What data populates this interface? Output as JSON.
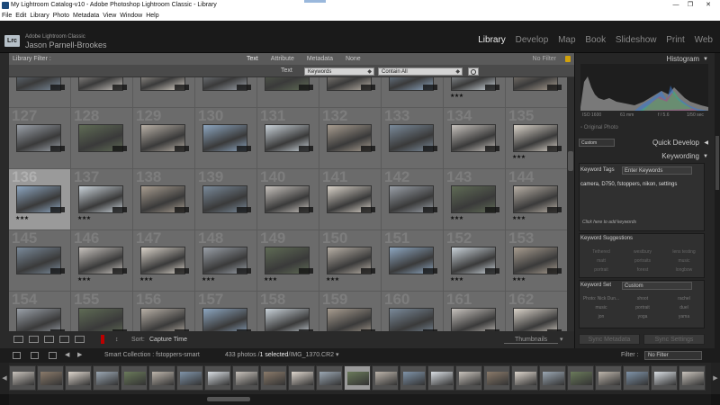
{
  "window": {
    "title": "My Lightroom Catalog-v10 - Adobe Photoshop Lightroom Classic - Library"
  },
  "menu": [
    "File",
    "Edit",
    "Library",
    "Photo",
    "Metadata",
    "View",
    "Window",
    "Help"
  ],
  "identity": {
    "logo": "Lrc",
    "app": "Adobe Lightroom Classic",
    "user": "Jason Parnell-Brookes"
  },
  "modules": [
    "Library",
    "Develop",
    "Map",
    "Book",
    "Slideshow",
    "Print",
    "Web"
  ],
  "active_module": "Library",
  "filter_bar": {
    "label": "Library Filter :",
    "tabs": [
      "Text",
      "Attribute",
      "Metadata",
      "None"
    ],
    "active_tab": "Text",
    "preset": "No Filter",
    "text_label": "Text",
    "field": "Keywords",
    "rule": "Contain All"
  },
  "grid_rows": [
    {
      "nums": [
        "",
        "",
        "",
        "",
        "",
        "",
        "",
        "",
        ""
      ],
      "stars": [
        "",
        "",
        "",
        "",
        "",
        "",
        "",
        "★★★",
        ""
      ]
    },
    {
      "nums": [
        "127",
        "128",
        "129",
        "130",
        "131",
        "132",
        "133",
        "134",
        "135"
      ],
      "stars": [
        "",
        "",
        "",
        "",
        "",
        "",
        "",
        "",
        "★★★"
      ]
    },
    {
      "nums": [
        "136",
        "137",
        "138",
        "139",
        "140",
        "141",
        "142",
        "143",
        "144"
      ],
      "stars": [
        "★★★",
        "★★★",
        "",
        "",
        "",
        "",
        "",
        "★★★",
        "★★★"
      ]
    },
    {
      "nums": [
        "145",
        "146",
        "147",
        "148",
        "149",
        "150",
        "151",
        "152",
        "153"
      ],
      "stars": [
        "",
        "★★★",
        "★★★",
        "★★★",
        "★★★",
        "★★★",
        "",
        "★★★",
        "★★★"
      ]
    },
    {
      "nums": [
        "154",
        "155",
        "156",
        "157",
        "158",
        "159",
        "160",
        "161",
        "162"
      ],
      "stars": [
        "",
        "",
        "",
        "",
        "",
        "",
        "",
        "",
        ""
      ]
    }
  ],
  "selected_photo": "136",
  "toolbar": {
    "sort_label": "Sort:",
    "sort_value": "Capture Time",
    "thumbnails_label": "Thumbnails"
  },
  "right_panel": {
    "histogram_title": "Histogram",
    "exif": {
      "iso": "ISO 1600",
      "focal": "61 mm",
      "aperture": "f / 5.6",
      "shutter": "1/50 sec"
    },
    "original_photo": "Original Photo",
    "quick_develop": {
      "title": "Quick Develop",
      "preset": "Custom"
    },
    "keywording": {
      "title": "Keywording",
      "tags_label": "Keyword Tags",
      "tags_mode": "Enter Keywords",
      "keywords": "camera, D750, fstoppers, nikon, settings",
      "click_hint": "Click here to add keywords",
      "suggestions_title": "Keyword Suggestions",
      "suggestions": [
        "Tethered",
        "westbury",
        "lens testing",
        "matt",
        "portraits",
        "music",
        "portrait",
        "forest",
        "longbow"
      ],
      "set_label": "Keyword Set",
      "set_value": "Custom",
      "set_items": [
        "Photo: Nick Dun...",
        "shoot",
        "rachel",
        "music",
        "portrait",
        "duel",
        "jon",
        "yoga",
        "yama"
      ]
    },
    "buttons": {
      "sync_metadata": "Sync Metadata",
      "sync_settings": "Sync Settings"
    }
  },
  "filmstrip_bar": {
    "source": "Smart Collection : fstoppers-smart",
    "count_prefix": "433 photos /",
    "count_selected": "1 selected",
    "count_file": "/IMG_1370.CR2 ▾",
    "filter_label": "Filter :",
    "filter_value": "No Filter"
  },
  "colors": {
    "accent_lock": "#d1a10a",
    "panel_bg": "#262626",
    "grid_bg": "#6b6b6b",
    "selected_cell": "#9a9a9a"
  }
}
